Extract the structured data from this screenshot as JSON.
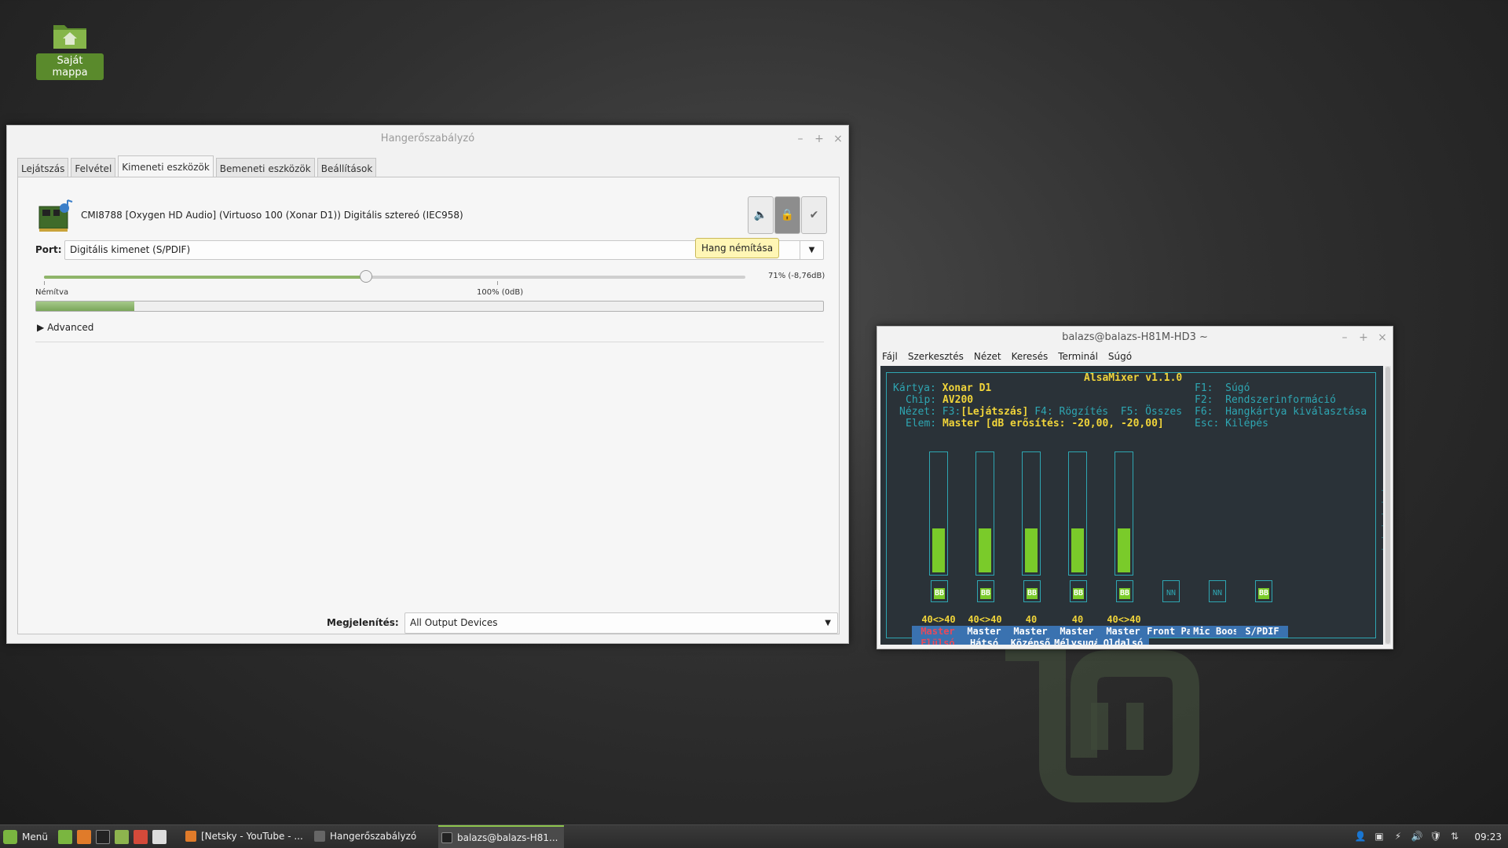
{
  "desktop": {
    "home_folder_label": "Saját mappa"
  },
  "volume_window": {
    "title": "Hangerőszabályzó",
    "tabs": [
      {
        "label": "Lejátszás",
        "active": false
      },
      {
        "label": "Felvétel",
        "active": false
      },
      {
        "label": "Kimeneti eszközök",
        "active": true
      },
      {
        "label": "Bemeneti eszközök",
        "active": false
      },
      {
        "label": "Beállítások",
        "active": false
      }
    ],
    "device_name": "CMI8788 [Oxygen HD Audio] (Virtuoso 100 (Xonar D1)) Digitális sztereó (IEC958)",
    "port_label": "Port:",
    "port_value": "Digitális kimenet (S/PDIF)",
    "tooltip": "Hang némítása",
    "volume_text": "71% (-8,76dB)",
    "volume_fraction": 0.71,
    "label_muted": "Némítva",
    "label_100": "100% (0dB)",
    "peak_fraction": 0.125,
    "advanced_label": "Advanced",
    "show_label": "Megjelenítés:",
    "show_value": "All Output Devices"
  },
  "terminal": {
    "title": "balazs@balazs-H81M-HD3 ~",
    "menu": [
      "Fájl",
      "Szerkesztés",
      "Nézet",
      "Keresés",
      "Terminál",
      "Súgó"
    ],
    "alsamixer": {
      "title": "AlsaMixer v1.1.0",
      "card_label": "Kártya:",
      "card_value": "Xonar D1",
      "chip_label": "Chip:",
      "chip_value": "AV200",
      "view_label": "Nézet:",
      "view_f3": "F3:",
      "view_current": "[Lejátszás]",
      "view_f4": "F4: Rögzítés",
      "view_f5": "F5: Összes",
      "elem_label": "Elem:",
      "elem_value": "Master [dB erősítés: -20,00, -20,00]",
      "help": [
        "F1:  Súgó",
        "F2:  Rendszerinformáció",
        "F6:  Hangkártya kiválasztása",
        "Esc: Kilépés"
      ],
      "channels": [
        {
          "values": "40<>40",
          "name1": "Master",
          "name2": "Elülsó",
          "mute": "BB",
          "level": 0.37,
          "selected": true
        },
        {
          "values": "40<>40",
          "name1": "Master",
          "name2": "Hátsó",
          "mute": "BB",
          "level": 0.37,
          "selected": false
        },
        {
          "values": "40",
          "name1": "Master",
          "name2": "Középső",
          "mute": "BB",
          "level": 0.37,
          "selected": false
        },
        {
          "values": "40",
          "name1": "Master",
          "name2": "Mélysugá",
          "mute": "BB",
          "level": 0.37,
          "selected": false
        },
        {
          "values": "40<>40",
          "name1": "Master",
          "name2": "Oldalsó",
          "mute": "BB",
          "level": 0.37,
          "selected": false
        },
        {
          "values": "",
          "name1": "Front Pa",
          "name2": "",
          "mute": "NN",
          "level": null,
          "selected": false
        },
        {
          "values": "",
          "name1": "Mic Boos",
          "name2": "",
          "mute": "NN",
          "level": null,
          "selected": false
        },
        {
          "values": "",
          "name1": "S/PDIF",
          "name2": "",
          "mute": "BB",
          "level": null,
          "selected": false
        }
      ]
    }
  },
  "taskbar": {
    "menu_label": "Menü",
    "windows": [
      {
        "label": "[Netsky - YouTube - ...",
        "active": false
      },
      {
        "label": "Hangerőszabályzó",
        "active": false
      },
      {
        "label": "balazs@balazs-H81...",
        "active": true
      }
    ],
    "clock": "09:23"
  },
  "colors": {
    "accent_green": "#8fb56a",
    "terminal_bg": "#2a3238",
    "terminal_cyan": "#2ea6b2",
    "terminal_yellow": "#f0d43a",
    "mint_green": "#7ab640"
  }
}
